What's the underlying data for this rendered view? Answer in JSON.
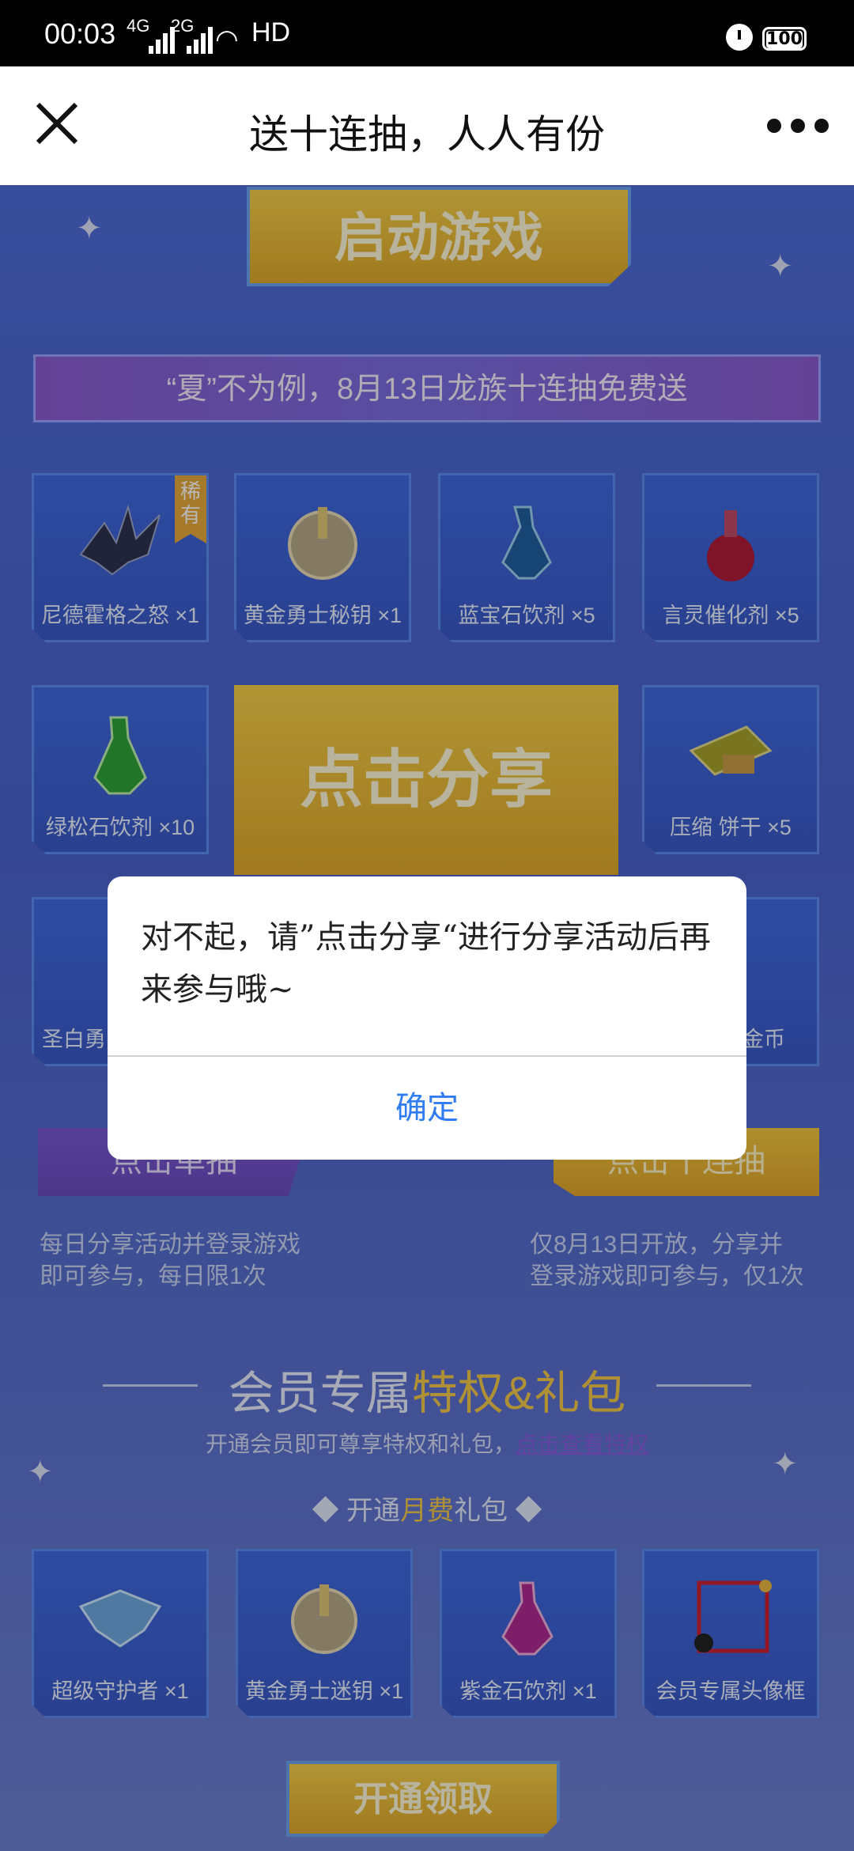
{
  "status_bar": {
    "time": "00:03",
    "network_1": "4G",
    "network_2": "2G",
    "wifi": "HD",
    "battery": "100"
  },
  "header": {
    "title": "送十连抽，人人有份"
  },
  "game": {
    "start_button": "启动游戏",
    "banner": "“夏”不为例，8月13日龙族十连抽免费送",
    "rare_badge": "稀有",
    "rewards_row1": [
      {
        "label": "尼德霍格之怒 ×1",
        "icon": "dragon-icon"
      },
      {
        "label": "黄金勇士秘钥 ×1",
        "icon": "golden-key-icon"
      },
      {
        "label": "蓝宝石饮剂 ×5",
        "icon": "blue-potion-icon"
      },
      {
        "label": "言灵催化剂 ×5",
        "icon": "red-potion-icon"
      }
    ],
    "rewards_row2": [
      {
        "label": "绿松石饮剂 ×10",
        "icon": "green-potion-icon"
      },
      {
        "label": "压缩 饼干 ×5",
        "icon": "biscuit-icon"
      }
    ],
    "rewards_row3": [
      {
        "label": "圣白勇",
        "icon": "shield-icon"
      },
      {
        "label": "金币",
        "icon": "coin-icon"
      }
    ],
    "share_button": "点击分享",
    "single_draw_button": "点击单抽",
    "ten_draw_button": "点击十连抽",
    "single_note": "每日分享活动并登录游戏\n即可参与，每日限1次",
    "ten_note": "仅8月13日开放，分享并\n登录游戏即可参与，仅1次",
    "vip_title_plain": "会员专属",
    "vip_title_highlight": "特权&礼包",
    "vip_subtitle": "开通会员即可尊享特权和礼包，",
    "vip_link": "点击查看特权",
    "monthly_head_pre": "◆ 开通",
    "monthly_head_highlight": "月费",
    "monthly_head_post": "礼包 ◆",
    "vip_rewards": [
      {
        "label": "超级守护者 ×1",
        "icon": "crest-icon"
      },
      {
        "label": "黄金勇士迷钥 ×1",
        "icon": "golden-key-icon"
      },
      {
        "label": "紫金石饮剂 ×1",
        "icon": "purple-potion-icon"
      },
      {
        "label": "会员专属头像框",
        "icon": "avatar-frame-icon"
      }
    ],
    "claim_button": "开通领取"
  },
  "dialog": {
    "message": "对不起，请”点击分享“进行分享活动后再来参与哦~",
    "ok_button": "确定"
  },
  "colors": {
    "accent_blue": "#2f7cf3",
    "gold": "#f3c84a",
    "purple": "#7a58d4"
  }
}
